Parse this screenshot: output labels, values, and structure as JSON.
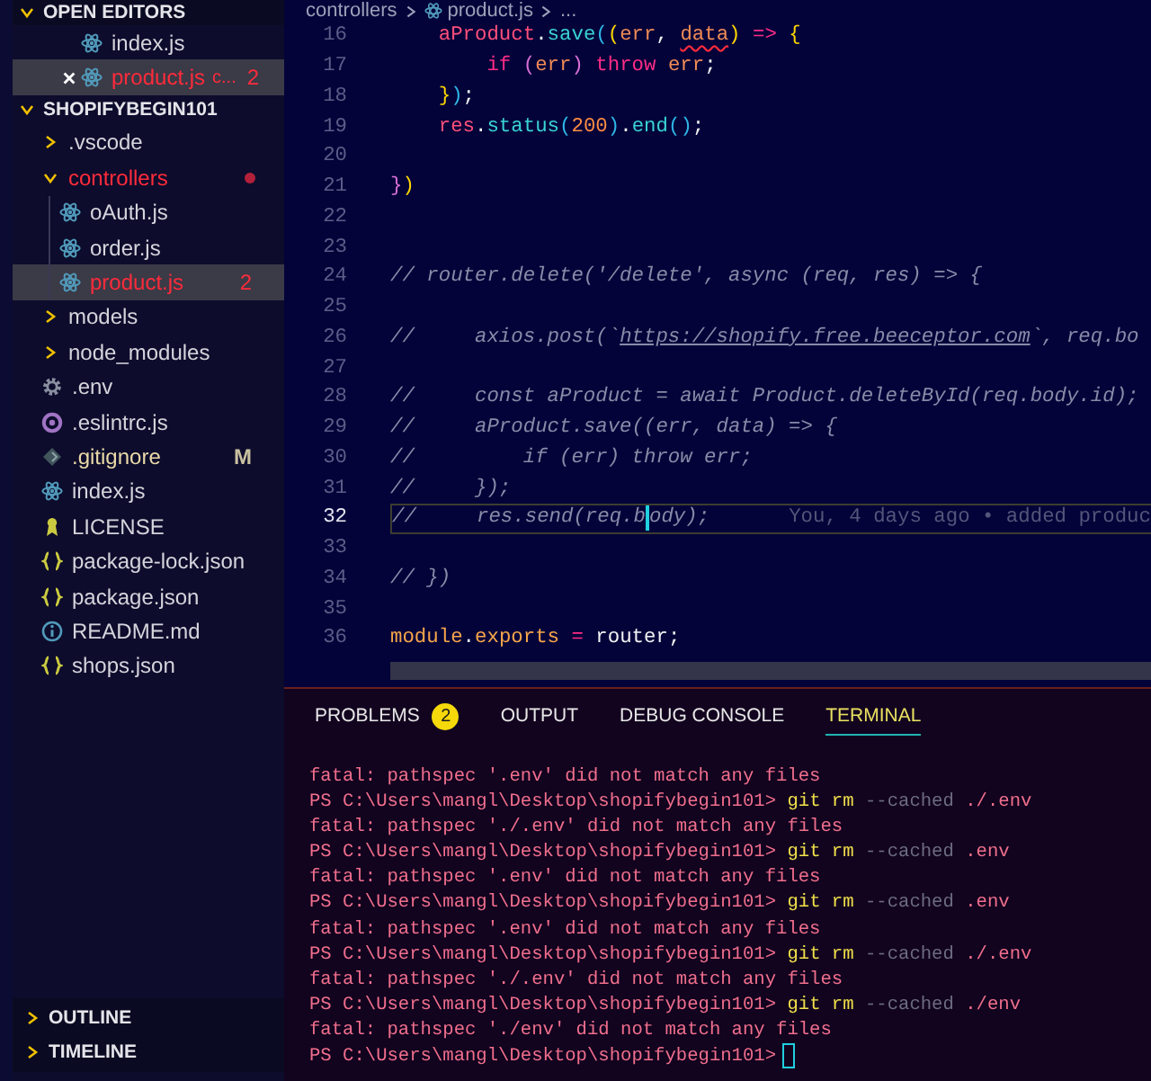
{
  "sidebar": {
    "open_editors": {
      "title": "OPEN EDITORS",
      "expanded": true,
      "items": [
        {
          "label": "index.js",
          "kind": "react",
          "selected": false,
          "error": false
        },
        {
          "label": "product.js",
          "detail": "c...",
          "badge": "2",
          "kind": "react",
          "selected": true,
          "error": true
        }
      ]
    },
    "explorer": {
      "title": "SHOPIFYBEGIN101",
      "expanded": true,
      "items": [
        {
          "label": ".vscode",
          "kind": "folder",
          "expanded": false,
          "selected": false,
          "error": false,
          "modified": false
        },
        {
          "label": "controllers",
          "kind": "folder",
          "expanded": true,
          "selected": false,
          "error": true,
          "modified": false,
          "dot": true,
          "children": [
            {
              "label": "oAuth.js",
              "kind": "react",
              "selected": false,
              "error": false,
              "modified": false
            },
            {
              "label": "order.js",
              "kind": "react",
              "selected": false,
              "error": false,
              "modified": false
            },
            {
              "label": "product.js",
              "kind": "react",
              "selected": true,
              "error": true,
              "modified": false,
              "badge": "2"
            }
          ]
        },
        {
          "label": "models",
          "kind": "folder",
          "expanded": false,
          "selected": false,
          "error": false,
          "modified": false
        },
        {
          "label": "node_modules",
          "kind": "folder",
          "expanded": false,
          "selected": false,
          "error": false,
          "modified": false
        },
        {
          "label": ".env",
          "kind": "gear",
          "selected": false,
          "error": false,
          "modified": false
        },
        {
          "label": ".eslintrc.js",
          "kind": "eslint",
          "selected": false,
          "error": false,
          "modified": false
        },
        {
          "label": ".gitignore",
          "kind": "git",
          "selected": false,
          "error": false,
          "modified": true,
          "badge": "M"
        },
        {
          "label": "index.js",
          "kind": "react",
          "selected": false,
          "error": false,
          "modified": false
        },
        {
          "label": "LICENSE",
          "kind": "license",
          "selected": false,
          "error": false,
          "modified": false
        },
        {
          "label": "package-lock.json",
          "kind": "json",
          "selected": false,
          "error": false,
          "modified": false
        },
        {
          "label": "package.json",
          "kind": "json",
          "selected": false,
          "error": false,
          "modified": false
        },
        {
          "label": "README.md",
          "kind": "info",
          "selected": false,
          "error": false,
          "modified": false
        },
        {
          "label": "shops.json",
          "kind": "json",
          "selected": false,
          "error": false,
          "modified": false
        }
      ]
    },
    "sections": [
      {
        "title": "OUTLINE",
        "expanded": false
      },
      {
        "title": "TIMELINE",
        "expanded": false
      }
    ]
  },
  "breadcrumb": [
    {
      "label": "controllers",
      "kind": "folder"
    },
    {
      "label": "product.js",
      "kind": "react"
    },
    {
      "label": "...",
      "kind": "more"
    }
  ],
  "editor": {
    "lines": [
      {
        "number": "16",
        "current": false,
        "tokens": [
          {
            "text": "    aProduct",
            "kind": "var"
          },
          {
            "text": ".",
            "kind": "punct"
          },
          {
            "text": "save",
            "kind": "method"
          },
          {
            "text": "(",
            "kind": "bracket3"
          },
          {
            "text": "(",
            "kind": "bracket1"
          },
          {
            "text": "err",
            "kind": "param"
          },
          {
            "text": ", ",
            "kind": "punct"
          },
          {
            "text": "data",
            "kind": "param",
            "squiggle": true
          },
          {
            "text": ")",
            "kind": "bracket1"
          },
          {
            "text": " =>",
            "kind": "keyword"
          },
          {
            "text": " {",
            "kind": "bracket1"
          }
        ]
      },
      {
        "number": "17",
        "current": false,
        "tokens": [
          {
            "text": "        if",
            "kind": "keyword"
          },
          {
            "text": " (",
            "kind": "bracket2"
          },
          {
            "text": "err",
            "kind": "param"
          },
          {
            "text": ")",
            "kind": "bracket2"
          },
          {
            "text": " throw",
            "kind": "keyword"
          },
          {
            "text": " err",
            "kind": "param"
          },
          {
            "text": ";",
            "kind": "punct"
          }
        ]
      },
      {
        "number": "18",
        "current": false,
        "tokens": [
          {
            "text": "    }",
            "kind": "bracket1"
          },
          {
            "text": ")",
            "kind": "bracket3"
          },
          {
            "text": ";",
            "kind": "punct"
          }
        ]
      },
      {
        "number": "19",
        "current": false,
        "tokens": [
          {
            "text": "    res",
            "kind": "var"
          },
          {
            "text": ".",
            "kind": "punct"
          },
          {
            "text": "status",
            "kind": "method"
          },
          {
            "text": "(",
            "kind": "bracket3"
          },
          {
            "text": "200",
            "kind": "number"
          },
          {
            "text": ")",
            "kind": "bracket3"
          },
          {
            "text": ".",
            "kind": "punct"
          },
          {
            "text": "end",
            "kind": "method"
          },
          {
            "text": "()",
            "kind": "bracket3"
          },
          {
            "text": ";",
            "kind": "punct"
          }
        ]
      },
      {
        "number": "20",
        "current": false
      },
      {
        "number": "21",
        "current": false,
        "tokens": [
          {
            "text": "}",
            "kind": "bracket2"
          },
          {
            "text": ")",
            "kind": "bracket1"
          }
        ]
      },
      {
        "number": "22",
        "current": false
      },
      {
        "number": "23",
        "current": false
      },
      {
        "number": "24",
        "current": false,
        "tokens": [
          {
            "text": "// router.delete('/delete', async (req, res) => {",
            "kind": "comment"
          }
        ]
      },
      {
        "number": "25",
        "current": false
      },
      {
        "number": "26",
        "current": false,
        "tokens": [
          {
            "text": "//     axios.post(`",
            "kind": "comment"
          },
          {
            "text": "https://shopify.free.beeceptor.com",
            "kind": "link"
          },
          {
            "text": "`, req.bo",
            "kind": "comment"
          }
        ]
      },
      {
        "number": "27",
        "current": false
      },
      {
        "number": "28",
        "current": false,
        "tokens": [
          {
            "text": "//     const aProduct = await Product.deleteById(req.body.id);",
            "kind": "comment"
          }
        ]
      },
      {
        "number": "29",
        "current": false,
        "tokens": [
          {
            "text": "//     aProduct.save((err, data) => {",
            "kind": "comment"
          }
        ]
      },
      {
        "number": "30",
        "current": false,
        "tokens": [
          {
            "text": "//         if (err) throw err;",
            "kind": "comment"
          }
        ]
      },
      {
        "number": "31",
        "current": false,
        "tokens": [
          {
            "text": "//     });",
            "kind": "comment"
          }
        ]
      },
      {
        "number": "32",
        "current": true,
        "blame": "You, 4 days ago • added produc",
        "tokens": [
          {
            "text": "//     res.send(req.b",
            "kind": "comment"
          },
          {
            "kind": "cursor"
          },
          {
            "text": "ody);",
            "kind": "comment"
          }
        ]
      },
      {
        "number": "33",
        "current": false
      },
      {
        "number": "34",
        "current": false,
        "tokens": [
          {
            "text": "// })",
            "kind": "comment"
          }
        ]
      },
      {
        "number": "35",
        "current": false
      },
      {
        "number": "36",
        "current": false,
        "tokens": [
          {
            "text": "module",
            "kind": "orange"
          },
          {
            "text": ".",
            "kind": "punct"
          },
          {
            "text": "exports",
            "kind": "orange"
          },
          {
            "text": " =",
            "kind": "keyword"
          },
          {
            "text": " router",
            "kind": "plain"
          },
          {
            "text": ";",
            "kind": "punct"
          }
        ]
      }
    ]
  },
  "panel": {
    "tabs": [
      {
        "label": "PROBLEMS",
        "badge": "2",
        "selected": false
      },
      {
        "label": "OUTPUT",
        "selected": false
      },
      {
        "label": "DEBUG CONSOLE",
        "selected": false
      },
      {
        "label": "TERMINAL",
        "selected": true
      }
    ],
    "terminal": {
      "lines": [
        {
          "kind": "output",
          "text": "fatal: pathspec '.env' did not match any files"
        },
        {
          "kind": "command",
          "prompt": "PS C:\\Users\\mangl\\Desktop\\shopifybegin101>",
          "command": "git rm",
          "flag": "--cached",
          "argument": "./.env",
          "cursor": false
        },
        {
          "kind": "output",
          "text": "fatal: pathspec './.env' did not match any files"
        },
        {
          "kind": "command",
          "prompt": "PS C:\\Users\\mangl\\Desktop\\shopifybegin101>",
          "command": "git rm",
          "flag": "--cached",
          "argument": ".env",
          "cursor": false
        },
        {
          "kind": "output",
          "text": "fatal: pathspec '.env' did not match any files"
        },
        {
          "kind": "command",
          "prompt": "PS C:\\Users\\mangl\\Desktop\\shopifybegin101>",
          "command": "git rm",
          "flag": "--cached",
          "argument": ".env",
          "cursor": false
        },
        {
          "kind": "output",
          "text": "fatal: pathspec '.env' did not match any files"
        },
        {
          "kind": "command",
          "prompt": "PS C:\\Users\\mangl\\Desktop\\shopifybegin101>",
          "command": "git rm",
          "flag": "--cached",
          "argument": "./.env",
          "cursor": false
        },
        {
          "kind": "output",
          "text": "fatal: pathspec './.env' did not match any files"
        },
        {
          "kind": "command",
          "prompt": "PS C:\\Users\\mangl\\Desktop\\shopifybegin101>",
          "command": "git rm",
          "flag": "--cached",
          "argument": "./env",
          "cursor": false
        },
        {
          "kind": "output",
          "text": "fatal: pathspec './env' did not match any files"
        },
        {
          "kind": "command",
          "prompt": "PS C:\\Users\\mangl\\Desktop\\shopifybegin101>",
          "cursor": true
        }
      ]
    }
  }
}
